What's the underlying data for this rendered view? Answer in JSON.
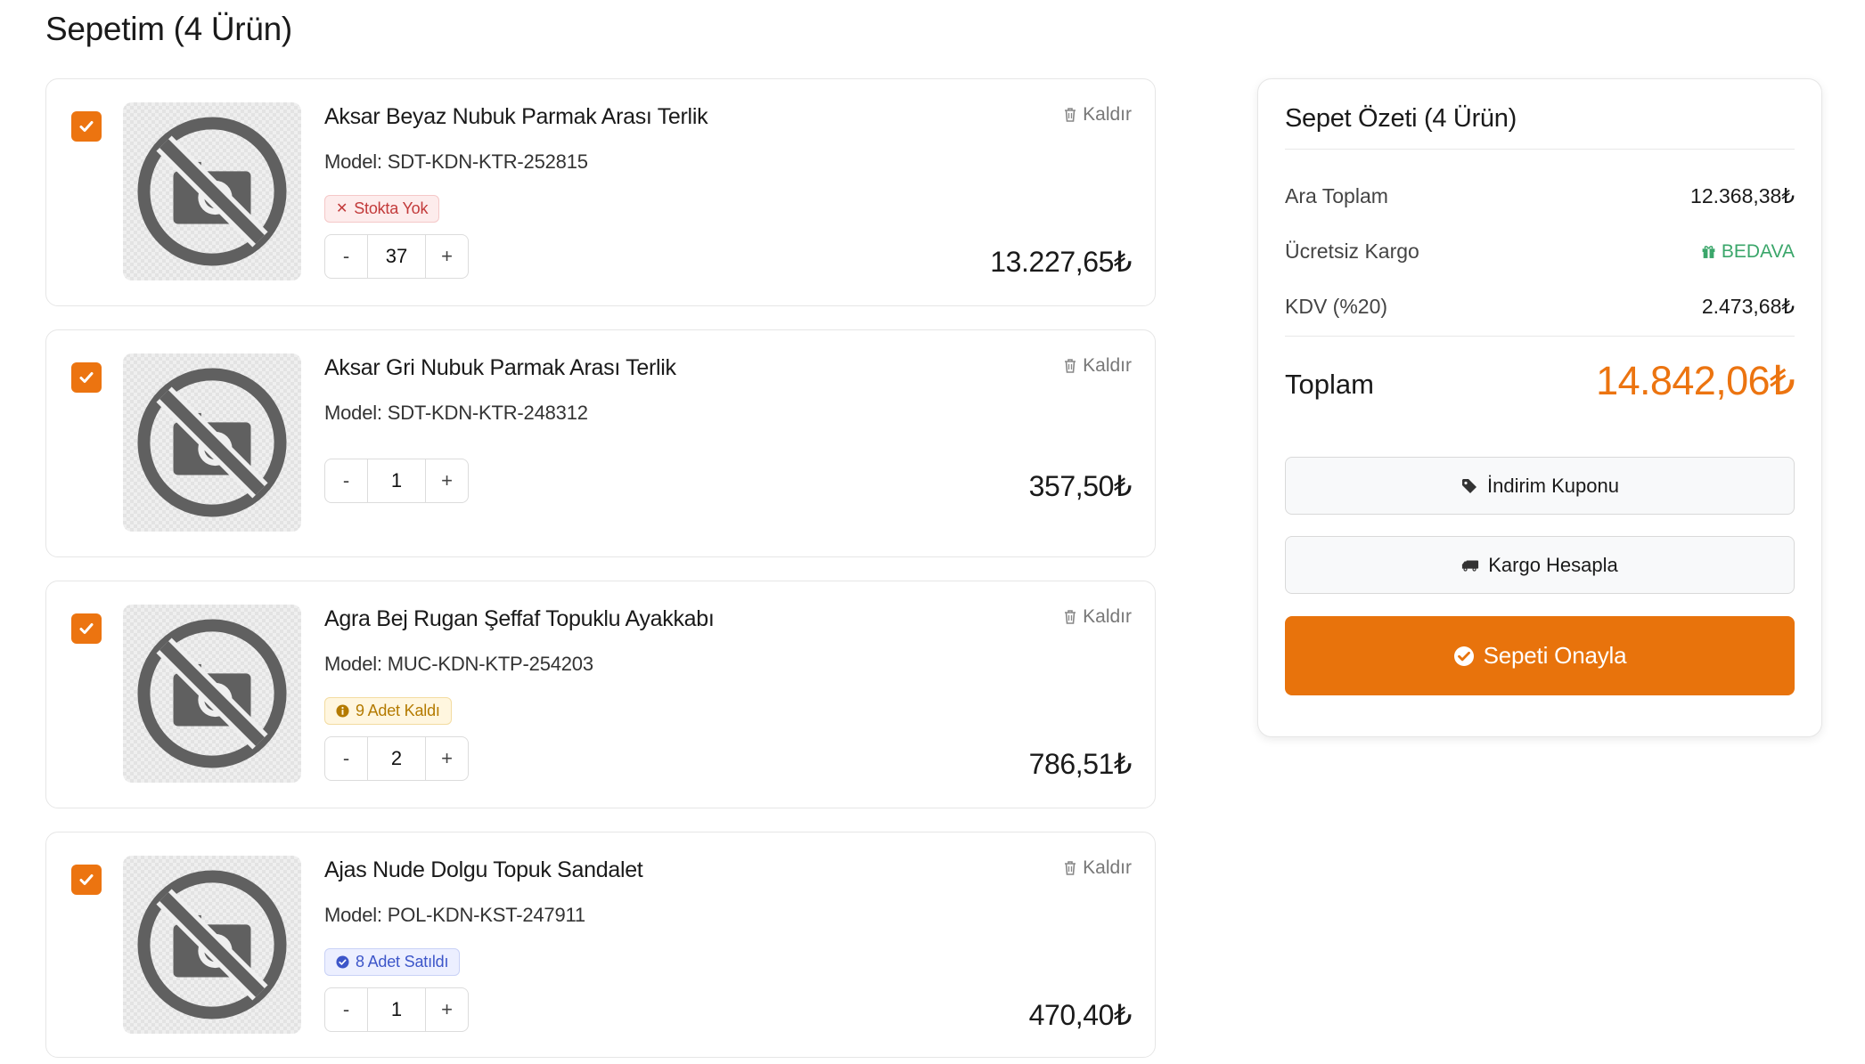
{
  "page": {
    "title": "Sepetim (4 Ürün)"
  },
  "colors": {
    "accent": "#ec7410",
    "free": "#3aa66a",
    "out_of_stock": "#c23a3a",
    "low_stock": "#b47a00",
    "sold": "#3d56c9"
  },
  "items": [
    {
      "name": "Aksar Beyaz Nubuk Parmak Arası Terlik",
      "model": "Model: SDT-KDN-KTR-252815",
      "badge": "Stokta Yok",
      "badge_icon": "x-icon",
      "quantity": "37",
      "price": "13.227,65₺",
      "remove": "Kaldır",
      "minus": "-",
      "plus": "+"
    },
    {
      "name": "Aksar Gri Nubuk Parmak Arası Terlik",
      "model": "Model: SDT-KDN-KTR-248312",
      "badge": null,
      "quantity": "1",
      "price": "357,50₺",
      "remove": "Kaldır",
      "minus": "-",
      "plus": "+"
    },
    {
      "name": "Agra Bej Rugan Şeffaf Topuklu Ayakkabı",
      "model": "Model: MUC-KDN-KTP-254203",
      "badge": "9 Adet Kaldı",
      "badge_icon": "info-icon",
      "quantity": "2",
      "price": "786,51₺",
      "remove": "Kaldır",
      "minus": "-",
      "plus": "+"
    },
    {
      "name": "Ajas Nude Dolgu Topuk Sandalet",
      "model": "Model: POL-KDN-KST-247911",
      "badge": "8 Adet Satıldı",
      "badge_icon": "check-circle-icon",
      "quantity": "1",
      "price": "470,40₺",
      "remove": "Kaldır",
      "minus": "-",
      "plus": "+"
    }
  ],
  "summary": {
    "title": "Sepet Özeti (4 Ürün)",
    "subtotal_label": "Ara Toplam",
    "subtotal_value": "12.368,38₺",
    "shipping_label": "Ücretsiz Kargo",
    "shipping_value": "BEDAVA",
    "vat_label": "KDV (%20)",
    "vat_value": "2.473,68₺",
    "total_label": "Toplam",
    "total_value": "14.842,06₺",
    "coupon_button": "İndirim Kuponu",
    "shipping_button": "Kargo Hesapla",
    "confirm_button": "Sepeti Onayla"
  }
}
